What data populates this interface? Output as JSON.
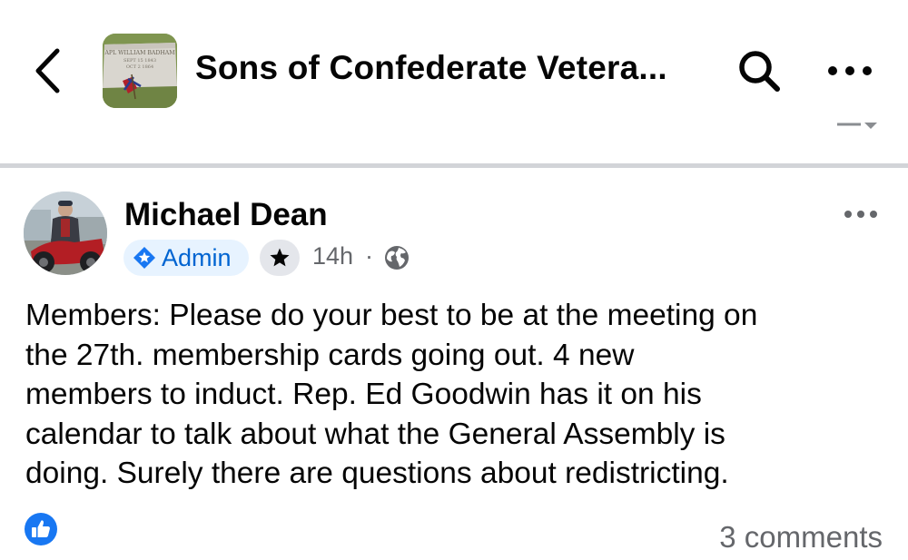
{
  "header": {
    "group_name": "Sons of Confederate Vetera...",
    "thumbnail_inscription": [
      "APL WILLIAM BADHAM",
      "SEPT 15 1843",
      "OCT 2 1864"
    ]
  },
  "post": {
    "author": "Michael Dean",
    "badge_admin": "Admin",
    "time": "14h",
    "separator": "·",
    "lines": [
      "Members: Please do your best to be at the meeting on",
      "the 27th. membership cards going out. 4 new",
      "members to induct. Rep. Ed Goodwin has it on his",
      "calendar to talk about what the General Assembly is",
      "doing. Surely there are questions about redistricting."
    ],
    "comments": "3 comments"
  },
  "colors": {
    "accent": "#1877f2",
    "admin_badge_bg": "#e7f3ff",
    "admin_badge_text": "#0064d1",
    "secondary_text": "#65676b",
    "divider": "#d2d4d8"
  },
  "icons": {
    "back": "chevron-left-icon",
    "search": "search-icon",
    "more": "more-horizontal-icon",
    "admin": "shield-star-icon",
    "star": "star-icon",
    "privacy": "globe-icon",
    "reaction": "like-icon"
  }
}
